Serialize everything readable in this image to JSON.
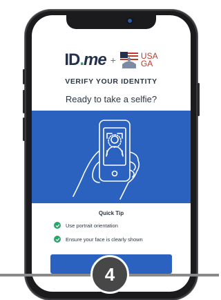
{
  "header": {
    "idme_logo_id": "ID",
    "idme_logo_dot": ".",
    "idme_logo_me": "me",
    "plus": "+",
    "partner_logo_line1": "USA",
    "partner_logo_line2": "GA"
  },
  "verify_title": "VERIFY YOUR IDENTITY",
  "ready_title": "Ready to take a selfie?",
  "quick_tip": {
    "title": "Quick Tip",
    "items": [
      "Use portrait orientation",
      "Ensure your face is clearly shown"
    ]
  },
  "step_number": "4",
  "colors": {
    "brand_blue": "#2b62c0",
    "check_green": "#2ba36a",
    "text_dark": "#2c3644",
    "step_badge": "#474747"
  }
}
